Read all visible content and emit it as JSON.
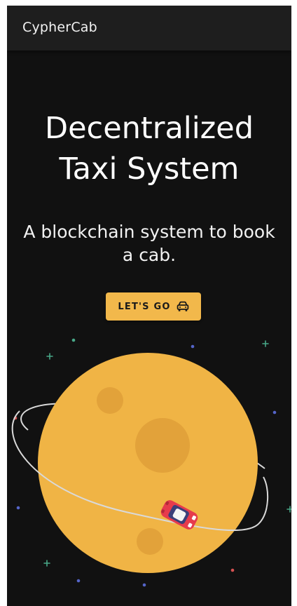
{
  "app_bar": {
    "title": "CypherCab"
  },
  "hero": {
    "title_line1": "Decentralized",
    "title_line2": "Taxi System",
    "subtitle_line1": "A blockchain system to book",
    "subtitle_line2": "a cab."
  },
  "cta": {
    "label": "LET'S GO",
    "icon": "car-icon"
  },
  "illustration": {
    "planet_icon": "planet-icon",
    "vehicle_icon": "taxi-car-icon"
  },
  "colors": {
    "background": "#111111",
    "app_bar": "#1e1e1e",
    "accent": "#f2b84b",
    "planet": "#f0b445",
    "crater": "#e2a23a",
    "car": "#e63b4c"
  }
}
